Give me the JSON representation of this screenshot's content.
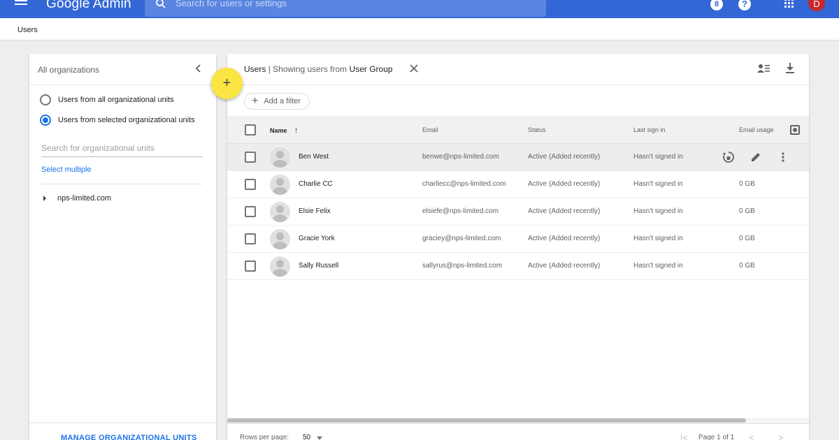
{
  "app": {
    "logo_google": "Google",
    "logo_admin": "Admin",
    "search_placeholder": "Search for users or settings",
    "notification_count": "8",
    "help_glyph": "?",
    "avatar_initial": "D",
    "colors": {
      "appbar": "#3367d6",
      "accent": "#1a73e8",
      "fab": "#fbe542"
    }
  },
  "breadcrumb": {
    "current": "Users"
  },
  "left_panel": {
    "title": "All organizations",
    "radios": [
      {
        "label": "Users from all organizational units",
        "checked": false
      },
      {
        "label": "Users from selected organizational units",
        "checked": true
      }
    ],
    "search_placeholder": "Search for organizational units",
    "select_multiple": "Select multiple",
    "tree_root": "nps-limited.com",
    "manage_label": "MANAGE ORGANIZATIONAL UNITS"
  },
  "fab": {
    "label": "+"
  },
  "main": {
    "title_prefix": "Users",
    "title_middle": "| Showing users from",
    "title_group": "User Group",
    "add_filter": "Add a filter",
    "columns": {
      "name": "Name",
      "email": "Email",
      "status": "Status",
      "last_sign_in": "Last sign in",
      "email_usage": "Email usage"
    },
    "rows": [
      {
        "name": "Ben West",
        "email": "benwe@nps-limited.com",
        "status": "Active (Added recently)",
        "last_sign_in": "Hasn't signed in",
        "email_usage": ""
      },
      {
        "name": "Charlie CC",
        "email": "charliecc@nps-limited.com",
        "status": "Active (Added recently)",
        "last_sign_in": "Hasn't signed in",
        "email_usage": "0 GB"
      },
      {
        "name": "Elsie Felix",
        "email": "elsiefe@nps-limited.com",
        "status": "Active (Added recently)",
        "last_sign_in": "Hasn't signed in",
        "email_usage": "0 GB"
      },
      {
        "name": "Gracie York",
        "email": "graciey@nps-limited.com",
        "status": "Active (Added recently)",
        "last_sign_in": "Hasn't signed in",
        "email_usage": "0 GB"
      },
      {
        "name": "Sally Russell",
        "email": "sallyrus@nps-limited.com",
        "status": "Active (Added recently)",
        "last_sign_in": "Hasn't signed in",
        "email_usage": "0 GB"
      }
    ],
    "footer": {
      "rows_per_page_label": "Rows per page:",
      "rows_per_page_value": "50",
      "page_label": "Page 1 of 1"
    }
  }
}
